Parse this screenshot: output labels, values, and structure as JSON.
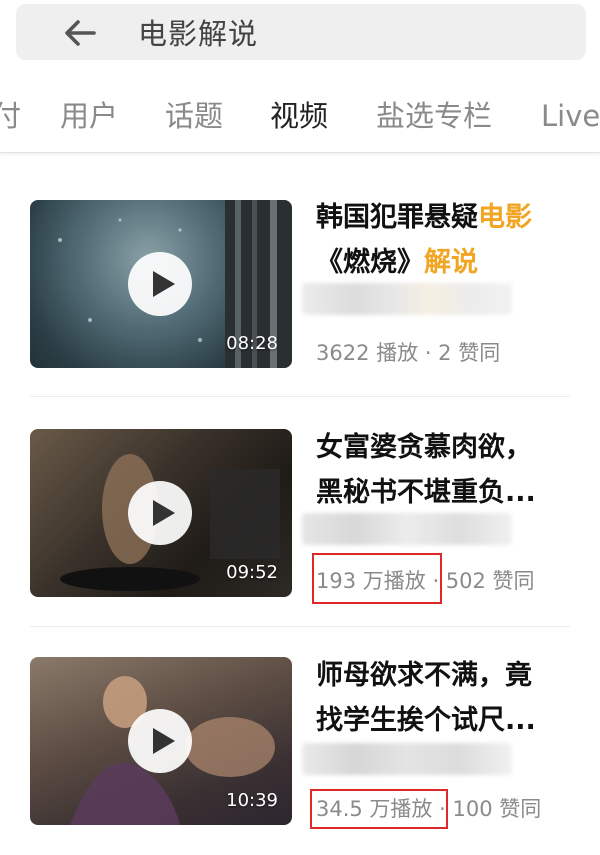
{
  "search": {
    "query": "电影解说"
  },
  "tabs": [
    {
      "label": "付"
    },
    {
      "label": "用户"
    },
    {
      "label": "话题"
    },
    {
      "label": "视频"
    },
    {
      "label": "盐选专栏"
    },
    {
      "label": "Live"
    }
  ],
  "active_tab": "视频",
  "videos": [
    {
      "title_parts": [
        "韩国犯罪悬疑",
        "电影",
        "《燃烧》",
        "解说"
      ],
      "duration": "08:28",
      "plays": "3622 播放",
      "likes": "· 2 赞同"
    },
    {
      "title_line1": "女富婆贪慕肉欲，",
      "title_line2": "黑秘书不堪重负...",
      "duration": "09:52",
      "plays": "193 万播放",
      "likes": "· 502 赞同"
    },
    {
      "title_line1": "师母欲求不满，竟",
      "title_line2": "找学生挨个试尺...",
      "duration": "10:39",
      "plays": "34.5 万播放",
      "likes": "· 100 赞同"
    }
  ],
  "colors": {
    "highlight": "#f2a522",
    "annotation_box": "#e02828"
  }
}
